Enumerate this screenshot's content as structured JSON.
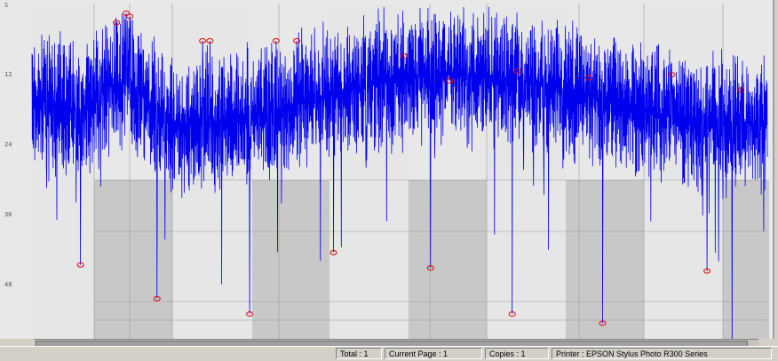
{
  "colors": {
    "signal": "#0000ee",
    "marker": "#dd0000",
    "band_light": "#e6e6e6",
    "band_dark": "#c8c8c8",
    "grid": "#9a9a9a"
  },
  "y_ticks": [
    "S",
    "12",
    "24",
    "36",
    "48"
  ],
  "chart_data": {
    "type": "line",
    "series": [
      {
        "peaks": [
          {
            "x": 0.115,
            "y": 0.05
          },
          {
            "x": 0.128,
            "y": 0.02
          },
          {
            "x": 0.133,
            "y": 0.03
          },
          {
            "x": 0.232,
            "y": 0.11
          },
          {
            "x": 0.242,
            "y": 0.11
          },
          {
            "x": 0.332,
            "y": 0.11
          },
          {
            "x": 0.36,
            "y": 0.11
          },
          {
            "x": 0.506,
            "y": 0.16
          },
          {
            "x": 0.568,
            "y": 0.24
          },
          {
            "x": 0.66,
            "y": 0.21
          },
          {
            "x": 0.757,
            "y": 0.23
          },
          {
            "x": 0.87,
            "y": 0.22
          },
          {
            "x": 0.964,
            "y": 0.27
          }
        ],
        "troughs": [
          {
            "x": 0.066,
            "y": 0.84
          },
          {
            "x": 0.17,
            "y": 0.95
          },
          {
            "x": 0.296,
            "y": 1.0
          },
          {
            "x": 0.41,
            "y": 0.8
          },
          {
            "x": 0.542,
            "y": 0.85
          },
          {
            "x": 0.653,
            "y": 1.0
          },
          {
            "x": 0.776,
            "y": 1.03
          },
          {
            "x": 0.918,
            "y": 0.86
          },
          {
            "x": 0.952,
            "y": 1.11
          }
        ]
      }
    ]
  },
  "statusbar": {
    "total_label": "Total :",
    "total_value": "1",
    "page_label": "Current Page :",
    "page_value": "1",
    "copies_label": "Copies :",
    "copies_value": "1",
    "printer_label": "Printer :",
    "printer_value": "EPSON Stylus Photo R300 Series"
  }
}
